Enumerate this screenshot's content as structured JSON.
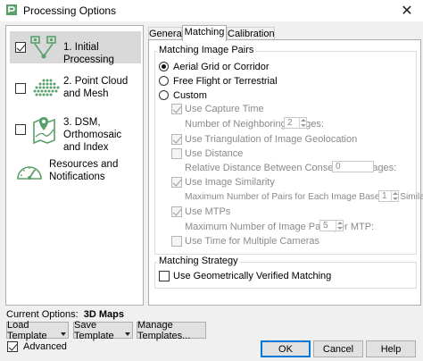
{
  "window": {
    "title": "Processing Options",
    "close_glyph": "✕"
  },
  "colors": {
    "accent": "#0078d7",
    "icon_green": "#5aa06b",
    "selected_bg": "#d9d9d9"
  },
  "steps": [
    {
      "label": "1. Initial Processing",
      "checked": true,
      "selected": true,
      "icon": "initial-processing-icon"
    },
    {
      "label": "2. Point Cloud and Mesh",
      "checked": false,
      "selected": false,
      "icon": "point-cloud-icon"
    },
    {
      "label": "3. DSM, Orthomosaic and Index",
      "checked": false,
      "selected": false,
      "icon": "dsm-map-icon"
    },
    {
      "label": "Resources and Notifications",
      "icon": "gauge-icon"
    }
  ],
  "current_options": {
    "label": "Current Options:",
    "value": "3D Maps"
  },
  "buttons": {
    "load_template": "Load Template",
    "save_template": "Save Template",
    "manage_templates": "Manage Templates...",
    "ok": "OK",
    "cancel": "Cancel",
    "help": "Help"
  },
  "advanced": {
    "label": "Advanced",
    "checked": true
  },
  "tabs": [
    {
      "label": "General",
      "active": false
    },
    {
      "label": "Matching",
      "active": true
    },
    {
      "label": "Calibration",
      "active": false
    }
  ],
  "matching_pairs": {
    "title": "Matching Image Pairs",
    "options": {
      "aerial": "Aerial Grid or Corridor",
      "free_flight": "Free Flight or Terrestrial",
      "custom": "Custom"
    },
    "selected": "aerial",
    "use_capture_time": "Use Capture Time",
    "neighboring_images_label": "Number of Neighboring Images:",
    "neighboring_images_value": "2",
    "use_triangulation": "Use Triangulation of Image Geolocation",
    "use_distance": "Use Distance",
    "relative_distance_label": "Relative Distance Between Consecutive Images:",
    "relative_distance_value": "0",
    "use_image_similarity": "Use Image Similarity",
    "max_pairs_similarity_label": "Maximum Number of Pairs for Each Image Based on Similarity:",
    "max_pairs_similarity_value": "1",
    "use_mtps": "Use MTPs",
    "max_pairs_mtp_label": "Maximum Number of Image Pairs per MTP:",
    "max_pairs_mtp_value": "5",
    "use_time_multiple_cameras": "Use Time for Multiple Cameras"
  },
  "matching_strategy": {
    "title": "Matching Strategy",
    "geometric_label": "Use Geometrically Verified Matching"
  }
}
